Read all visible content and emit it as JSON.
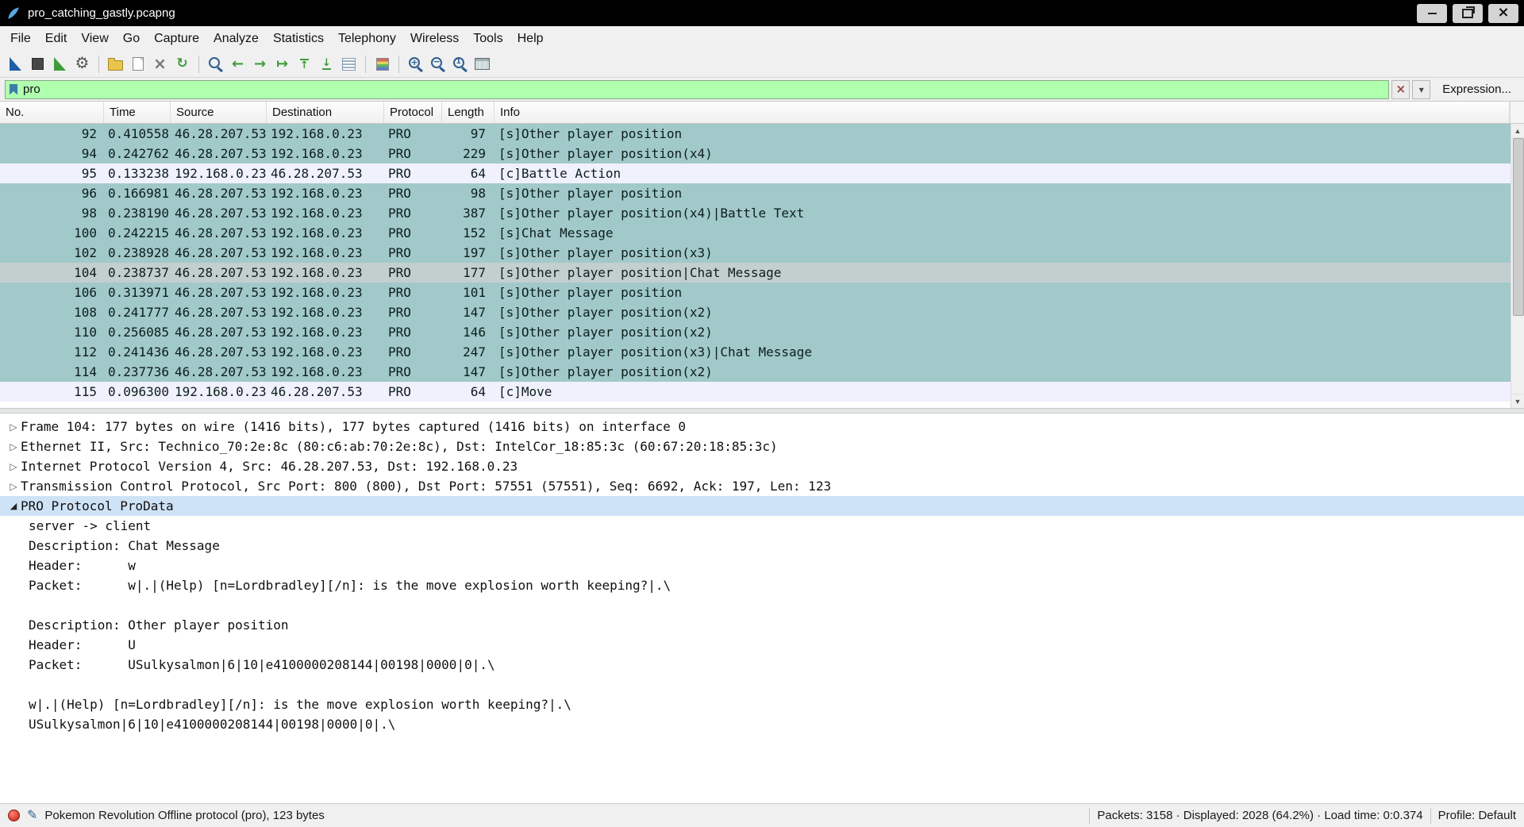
{
  "window": {
    "title": "pro_catching_gastly.pcapng"
  },
  "menu": {
    "items": [
      "File",
      "Edit",
      "View",
      "Go",
      "Capture",
      "Analyze",
      "Statistics",
      "Telephony",
      "Wireless",
      "Tools",
      "Help"
    ]
  },
  "toolbar": {
    "icons": [
      "start-capture",
      "stop-capture",
      "restart-capture",
      "capture-options",
      "open-file",
      "save-file",
      "close-file",
      "reload-file",
      "find-packet",
      "go-back",
      "go-forward",
      "go-to-packet",
      "go-to-top",
      "go-to-bottom",
      "auto-scroll",
      "colorize-packets",
      "zoom-in",
      "zoom-out",
      "zoom-100",
      "resize-columns"
    ]
  },
  "filter": {
    "value": "pro",
    "expression_label": "Expression..."
  },
  "packet_list": {
    "columns": [
      "No.",
      "Time",
      "Source",
      "Destination",
      "Protocol",
      "Length",
      "Info"
    ],
    "rows": [
      {
        "style": "server",
        "no": "92",
        "time": "0.410558",
        "source": "46.28.207.53",
        "destination": "192.168.0.23",
        "protocol": "PRO",
        "length": "97",
        "info": "[s]Other player position"
      },
      {
        "style": "server",
        "no": "94",
        "time": "0.242762",
        "source": "46.28.207.53",
        "destination": "192.168.0.23",
        "protocol": "PRO",
        "length": "229",
        "info": "[s]Other player position(x4)"
      },
      {
        "style": "client",
        "no": "95",
        "time": "0.133238",
        "source": "192.168.0.23",
        "destination": "46.28.207.53",
        "protocol": "PRO",
        "length": "64",
        "info": "[c]Battle Action"
      },
      {
        "style": "server",
        "no": "96",
        "time": "0.166981",
        "source": "46.28.207.53",
        "destination": "192.168.0.23",
        "protocol": "PRO",
        "length": "98",
        "info": "[s]Other player position"
      },
      {
        "style": "server",
        "no": "98",
        "time": "0.238190",
        "source": "46.28.207.53",
        "destination": "192.168.0.23",
        "protocol": "PRO",
        "length": "387",
        "info": "[s]Other player position(x4)|Battle Text"
      },
      {
        "style": "server",
        "no": "100",
        "time": "0.242215",
        "source": "46.28.207.53",
        "destination": "192.168.0.23",
        "protocol": "PRO",
        "length": "152",
        "info": "[s]Chat Message"
      },
      {
        "style": "server",
        "no": "102",
        "time": "0.238928",
        "source": "46.28.207.53",
        "destination": "192.168.0.23",
        "protocol": "PRO",
        "length": "197",
        "info": "[s]Other player position(x3)"
      },
      {
        "style": "selected",
        "no": "104",
        "time": "0.238737",
        "source": "46.28.207.53",
        "destination": "192.168.0.23",
        "protocol": "PRO",
        "length": "177",
        "info": "[s]Other player position|Chat Message"
      },
      {
        "style": "server",
        "no": "106",
        "time": "0.313971",
        "source": "46.28.207.53",
        "destination": "192.168.0.23",
        "protocol": "PRO",
        "length": "101",
        "info": "[s]Other player position"
      },
      {
        "style": "server",
        "no": "108",
        "time": "0.241777",
        "source": "46.28.207.53",
        "destination": "192.168.0.23",
        "protocol": "PRO",
        "length": "147",
        "info": "[s]Other player position(x2)"
      },
      {
        "style": "server",
        "no": "110",
        "time": "0.256085",
        "source": "46.28.207.53",
        "destination": "192.168.0.23",
        "protocol": "PRO",
        "length": "146",
        "info": "[s]Other player position(x2)"
      },
      {
        "style": "server",
        "no": "112",
        "time": "0.241436",
        "source": "46.28.207.53",
        "destination": "192.168.0.23",
        "protocol": "PRO",
        "length": "247",
        "info": "[s]Other player position(x3)|Chat Message"
      },
      {
        "style": "server",
        "no": "114",
        "time": "0.237736",
        "source": "46.28.207.53",
        "destination": "192.168.0.23",
        "protocol": "PRO",
        "length": "147",
        "info": "[s]Other player position(x2)"
      },
      {
        "style": "client",
        "no": "115",
        "time": "0.096300",
        "source": "192.168.0.23",
        "destination": "46.28.207.53",
        "protocol": "PRO",
        "length": "64",
        "info": "[c]Move"
      }
    ]
  },
  "details": {
    "lines": [
      {
        "expander": "collapsed",
        "state": "",
        "text": "Frame 104: 177 bytes on wire (1416 bits), 177 bytes captured (1416 bits) on interface 0"
      },
      {
        "expander": "collapsed",
        "state": "",
        "text": "Ethernet II, Src: Technico_70:2e:8c (80:c6:ab:70:2e:8c), Dst: IntelCor_18:85:3c (60:67:20:18:85:3c)"
      },
      {
        "expander": "collapsed",
        "state": "",
        "text": "Internet Protocol Version 4, Src: 46.28.207.53, Dst: 192.168.0.23"
      },
      {
        "expander": "collapsed",
        "state": "",
        "text": "Transmission Control Protocol, Src Port: 800 (800), Dst Port: 57551 (57551), Seq: 6692, Ack: 197, Len: 123"
      },
      {
        "expander": "expanded",
        "state": "selected",
        "text": "PRO Protocol ProData"
      },
      {
        "expander": "none",
        "state": "child",
        "text": "server -> client"
      },
      {
        "expander": "none",
        "state": "child",
        "text": "Description: Chat Message"
      },
      {
        "expander": "none",
        "state": "child",
        "text": "Header:      w"
      },
      {
        "expander": "none",
        "state": "child",
        "text": "Packet:      w|.|(Help) [n=Lordbradley][/n]: is the move explosion worth keeping?|.\\"
      },
      {
        "expander": "none",
        "state": "child",
        "text": ""
      },
      {
        "expander": "none",
        "state": "child",
        "text": "Description: Other player position"
      },
      {
        "expander": "none",
        "state": "child",
        "text": "Header:      U"
      },
      {
        "expander": "none",
        "state": "child",
        "text": "Packet:      USulkysalmon|6|10|e4100000208144|00198|0000|0|.\\"
      },
      {
        "expander": "none",
        "state": "child",
        "text": ""
      },
      {
        "expander": "none",
        "state": "child",
        "text": "w|.|(Help) [n=Lordbradley][/n]: is the move explosion worth keeping?|.\\"
      },
      {
        "expander": "none",
        "state": "child",
        "text": "USulkysalmon|6|10|e4100000208144|00198|0000|0|.\\"
      }
    ]
  },
  "status_bar": {
    "left": "Pokemon Revolution Offline protocol (pro), 123 bytes",
    "middle": "Packets: 3158 · Displayed: 2028 (64.2%) · Load time: 0:0.374",
    "right": "Profile: Default"
  },
  "colors": {
    "row_server": "#a1c9c9",
    "row_client": "#f0f1fc",
    "row_selected": "#c3cfcf",
    "filter_valid_bg": "#afffaf",
    "detail_selected_bg": "#cfe3f7",
    "titlebar_bg": "#000000",
    "expert_status": "#c41f0e"
  }
}
